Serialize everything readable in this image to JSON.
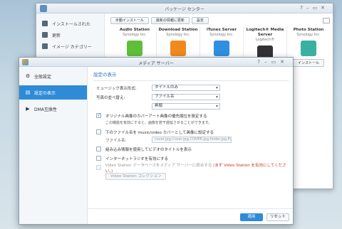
{
  "package_center": {
    "title": "パッケージ センター",
    "sidebar": [
      {
        "label": "インストールされた",
        "icon": "download-icon"
      },
      {
        "label": "更新",
        "icon": "refresh-icon"
      },
      {
        "label": "イメージ カテゴリー",
        "icon": "category-icon"
      }
    ],
    "toolbar": {
      "manual_install": "手動インストール",
      "refresh": "最新の情報に更新",
      "settings": "設定"
    },
    "packages": [
      {
        "name": "Audio Station",
        "vendor": "Synology Inc.",
        "color": "#5fbf3a",
        "button": ""
      },
      {
        "name": "Download Station",
        "vendor": "Synology Inc.",
        "color": "#f08a1c",
        "button": ""
      },
      {
        "name": "iTunes Server",
        "vendor": "Synology Inc.",
        "color": "#2f8fe0",
        "button": ""
      },
      {
        "name": "Logitech® Media Server",
        "vendor": "Logitech®",
        "color": "#333333",
        "button": ""
      },
      {
        "name": "Photo Station",
        "vendor": "Synology Inc.",
        "color": "#3ab0a0",
        "button": "インストール"
      }
    ]
  },
  "media_server": {
    "title": "メディア サーバー",
    "sidebar": [
      {
        "label": "全般設定",
        "icon": "gear-icon",
        "active": false
      },
      {
        "label": "設定の表示",
        "icon": "display-icon",
        "active": true
      },
      {
        "label": "DMA互換性",
        "icon": "compatibility-icon",
        "active": false
      }
    ],
    "section_title": "設定の表示",
    "music_display_label": "ミュージック表示形式:",
    "music_display_value": "タイトルのみ",
    "photo_sort_label": "写真の並べ替え:",
    "photo_sort_value": "ファイル名",
    "photo_order_value": "昇順",
    "option_cover": {
      "label": "オリジナル画像のカバーアート画像の優先順位を設定する",
      "checked": true,
      "note": "この機能を有効にすると、画像を若干遅延させることができます。"
    },
    "option_filename": {
      "label": "下のファイル名を music/video カバーとして画像に設定する",
      "checked": false
    },
    "filename_field_label": "ファイル名:",
    "filename_field_value": "cover.jpg,Cover.jpg,COVER.jpg,folder.jpg,Folder.jpg",
    "option_embedded_title": {
      "label": "組み込み情報を使用してビデオのタイトルを表示",
      "checked": false
    },
    "option_radio": {
      "label": "インターネットラジオを有効にする",
      "checked": false
    },
    "option_vs_prefix": "Video Station データベースをメディア サーバーに統合する",
    "option_vs_warning": "(まず Video Station を有効にしてください。)",
    "vs_collection_button": "Video Station コレクション",
    "apply_button": "適用",
    "reset_button": "リセット"
  }
}
